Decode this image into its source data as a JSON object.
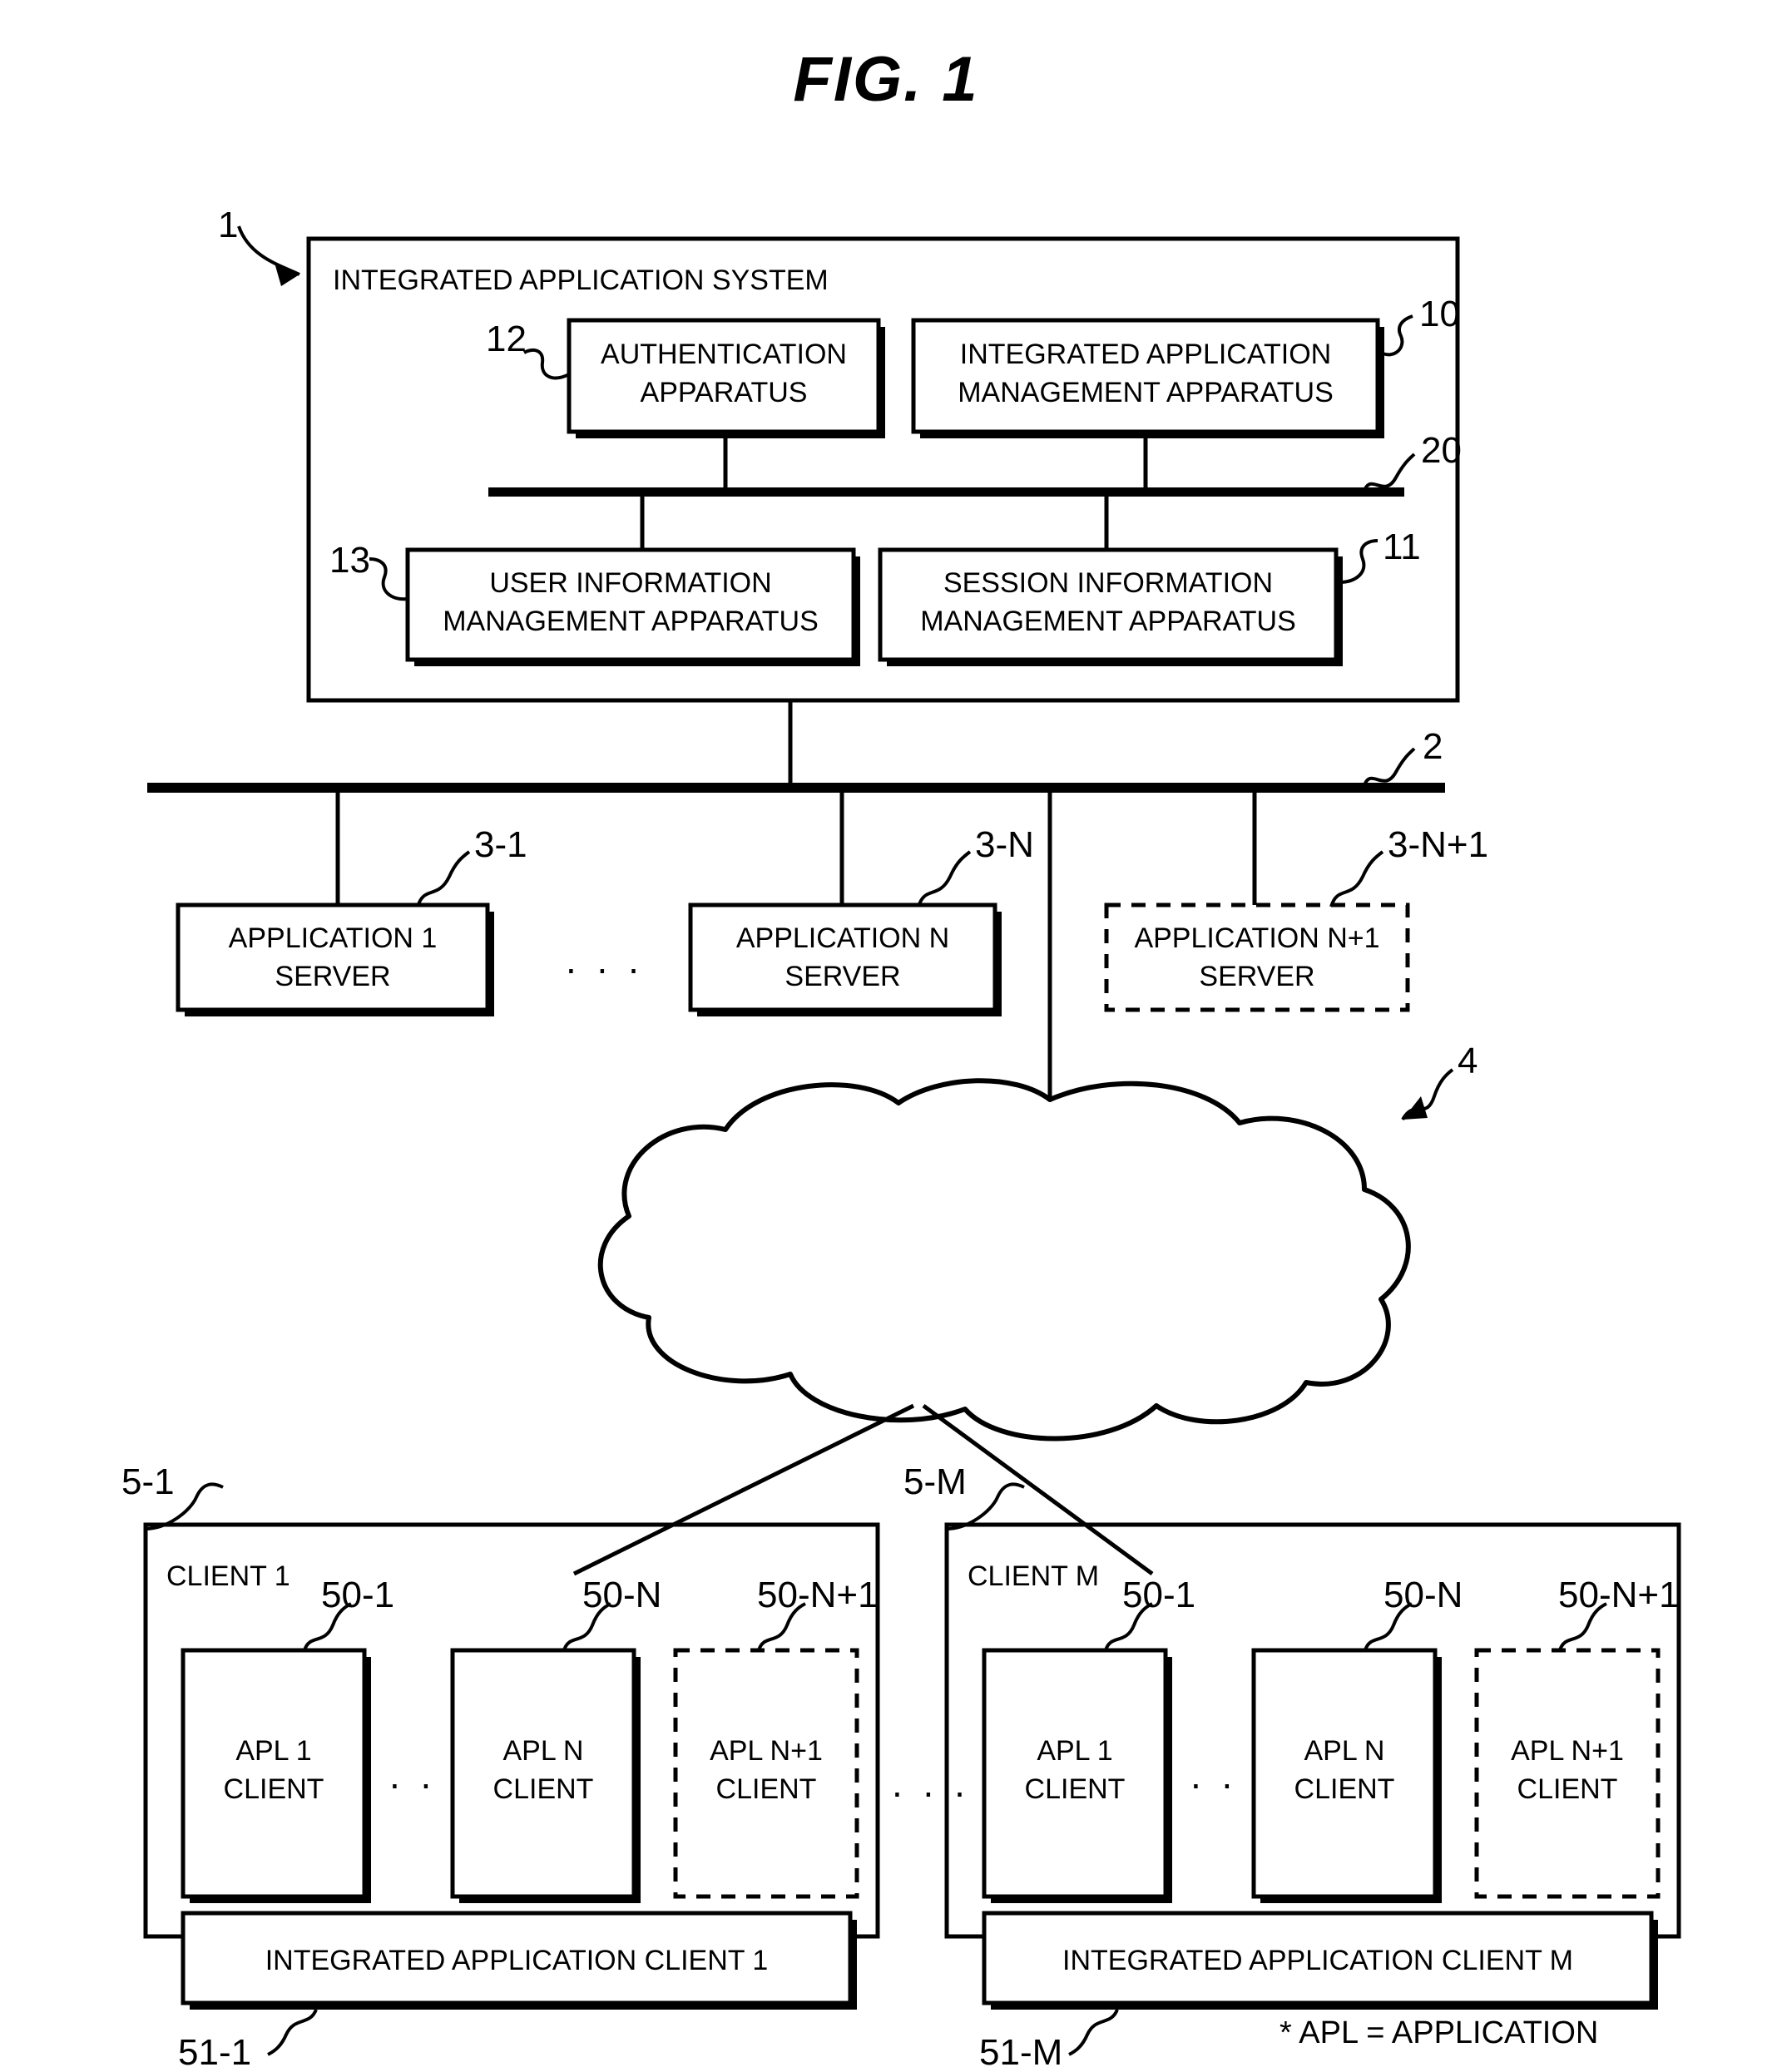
{
  "figure": {
    "title": "FIG.  1",
    "footnote": "* APL = APPLICATION"
  },
  "system": {
    "ref": "1",
    "title": "INTEGRATED APPLICATION SYSTEM",
    "internal_bus_ref": "20",
    "boxes": [
      {
        "ref": "12",
        "line1": "AUTHENTICATION",
        "line2": "APPARATUS"
      },
      {
        "ref": "10",
        "line1": "INTEGRATED APPLICATION",
        "line2": "MANAGEMENT APPARATUS"
      },
      {
        "ref": "13",
        "line1": "USER INFORMATION",
        "line2": "MANAGEMENT APPARATUS"
      },
      {
        "ref": "11",
        "line1": "SESSION INFORMATION",
        "line2": "MANAGEMENT APPARATUS"
      }
    ]
  },
  "network_bus": {
    "ref": "2"
  },
  "servers": {
    "ellipsis": ". . .",
    "items": [
      {
        "ref": "3-1",
        "line1": "APPLICATION 1",
        "line2": "SERVER",
        "dashed": false
      },
      {
        "ref": "3-N",
        "line1": "APPLICATION N",
        "line2": "SERVER",
        "dashed": false
      },
      {
        "ref": "3-N+1",
        "line1": "APPLICATION N+1",
        "line2": "SERVER",
        "dashed": true
      }
    ]
  },
  "cloud": {
    "ref": "4"
  },
  "clients": {
    "ellipsis_between": ". . .",
    "items": [
      {
        "ref": "5-1",
        "title": "CLIENT 1",
        "apl_ellipsis": ". . .",
        "apps": [
          {
            "ref": "50-1",
            "line1": "APL 1",
            "line2": "CLIENT",
            "dashed": false
          },
          {
            "ref": "50-N",
            "line1": "APL N",
            "line2": "CLIENT",
            "dashed": false
          },
          {
            "ref": "50-N+1",
            "line1": "APL N+1",
            "line2": "CLIENT",
            "dashed": true
          }
        ],
        "integrated": {
          "ref": "51-1",
          "label": "INTEGRATED APPLICATION CLIENT 1"
        }
      },
      {
        "ref": "5-M",
        "title": "CLIENT M",
        "apl_ellipsis": ". . .",
        "apps": [
          {
            "ref": "50-1",
            "line1": "APL 1",
            "line2": "CLIENT",
            "dashed": false
          },
          {
            "ref": "50-N",
            "line1": "APL N",
            "line2": "CLIENT",
            "dashed": false
          },
          {
            "ref": "50-N+1",
            "line1": "APL N+1",
            "line2": "CLIENT",
            "dashed": true
          }
        ],
        "integrated": {
          "ref": "51-M",
          "label": "INTEGRATED APPLICATION CLIENT M"
        }
      }
    ]
  }
}
